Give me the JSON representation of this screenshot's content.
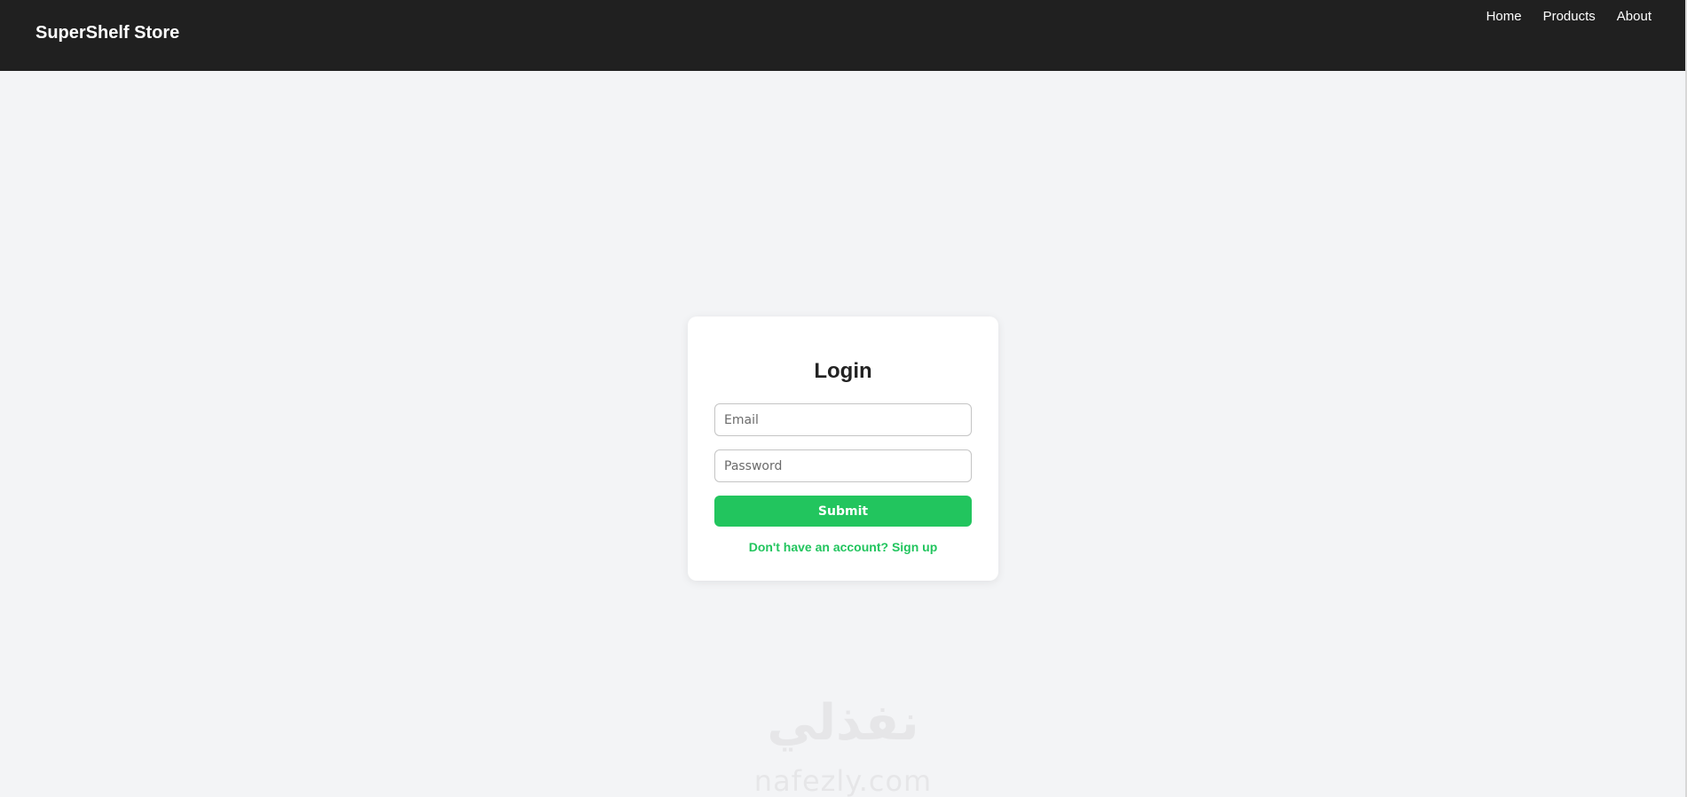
{
  "header": {
    "brand": "SuperShelf Store",
    "nav": [
      {
        "label": "Home"
      },
      {
        "label": "Products"
      },
      {
        "label": "About"
      }
    ]
  },
  "login": {
    "title": "Login",
    "email_placeholder": "Email",
    "password_placeholder": "Password",
    "submit_label": "Submit",
    "signup_text": "Don't have an account? Sign up"
  },
  "watermark": {
    "arabic": "نفذلي",
    "latin": "nafezly.com"
  },
  "colors": {
    "header_bg": "#202020",
    "page_bg": "#f3f4f6",
    "accent": "#22c55e"
  }
}
